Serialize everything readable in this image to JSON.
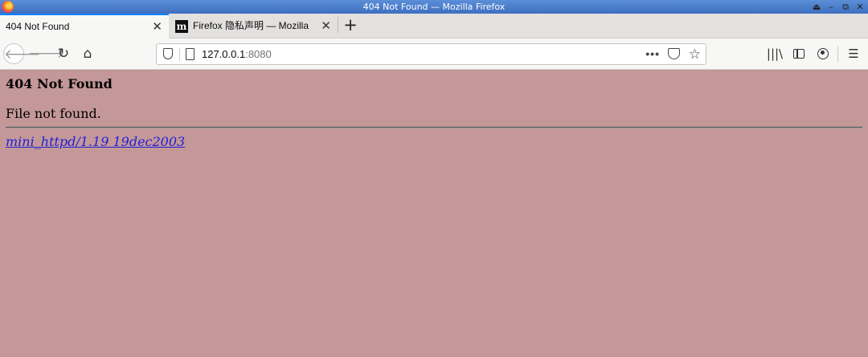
{
  "window": {
    "title": "404 Not Found — Mozilla Firefox",
    "controls": [
      "⏏",
      "–",
      "⧉",
      "✕"
    ]
  },
  "tabs": [
    {
      "label": "404 Not Found",
      "active": true,
      "icon": "none"
    },
    {
      "label": "Firefox 隐私声明 — Mozilla",
      "active": false,
      "icon": "mozilla-m-icon",
      "favicon_text": "m"
    }
  ],
  "toolbar": {
    "back_icon": "🡐",
    "forward_icon": "🡒",
    "reload_icon": "↻",
    "home_icon": "⌂",
    "new_tab_icon": "+",
    "close_tab_icon": "✕",
    "page_actions_icon": "•••",
    "bookmark_icon": "☆",
    "library_icon": "|||\\",
    "menu_icon": "☰"
  },
  "urlbar": {
    "host": "127.0.0.1",
    "port": ":8080"
  },
  "page": {
    "heading": "404 Not Found",
    "message": "File not found.",
    "server_link": "mini_httpd/1.19 19dec2003",
    "background": "#c49898",
    "link_color": "#2020d8"
  }
}
